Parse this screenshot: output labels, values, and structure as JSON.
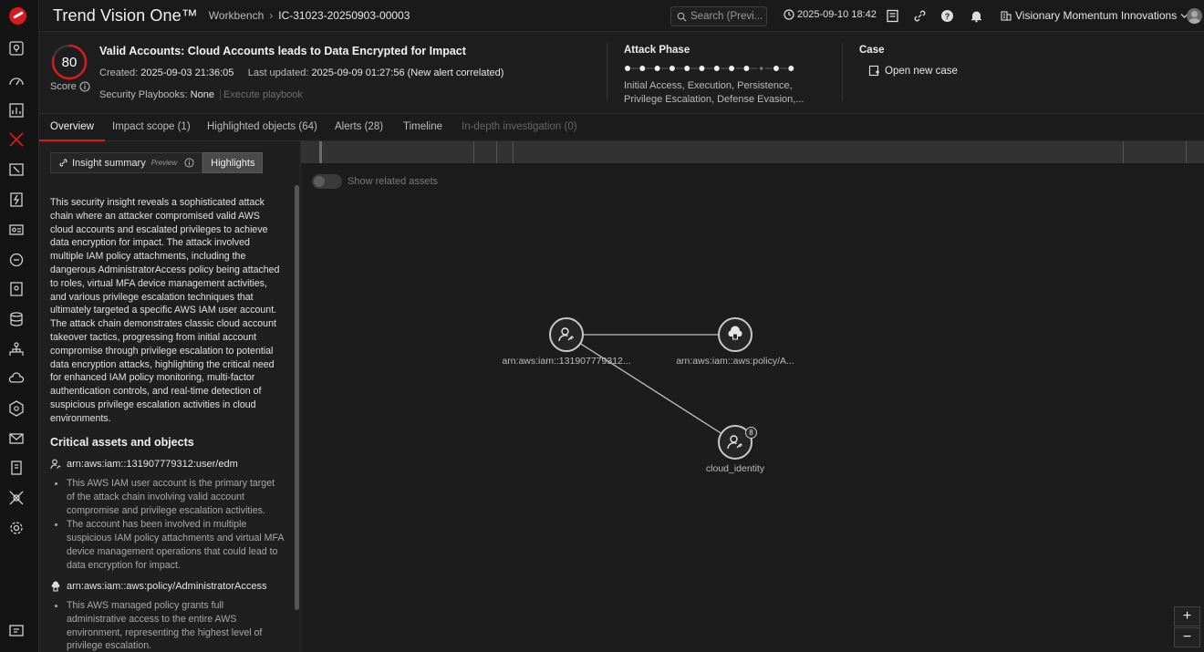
{
  "app": {
    "title": "Trend Vision One™",
    "breadcrumb_parent": "Workbench",
    "breadcrumb_sep": "›",
    "breadcrumb_current": "IC-31023-20250903-00003",
    "search_placeholder": "Search (Previ...",
    "datetime": "2025-09-10 18:42",
    "org": "Visionary Momentum Innovations"
  },
  "rail": {
    "items": [
      "map-pin-icon",
      "dashboard-icon",
      "reports-icon",
      "workbench-icon",
      "attack-surface-icon",
      "response-icon",
      "identity-icon",
      "threat-intel-icon",
      "endpoint-icon",
      "data-icon",
      "network-icon",
      "cloud-icon",
      "policy-icon",
      "email-icon",
      "mobile-icon",
      "xdr-icon",
      "settings-icon",
      "marketplace-icon"
    ]
  },
  "alert": {
    "score": "80",
    "score_value": 80,
    "score_label": "Score",
    "title": "Valid Accounts: Cloud Accounts leads to Data Encrypted for Impact",
    "created_label": "Created:",
    "created": "2025-09-03 21:36:05",
    "updated_label": "Last updated:",
    "updated": "2025-09-09 01:27:56 (New alert correlated)",
    "playbook_label": "Security Playbooks:",
    "playbook_value": "None",
    "playbook_action": "Execute playbook"
  },
  "attack_phase": {
    "heading": "Attack Phase",
    "phase_states": [
      1,
      1,
      1,
      1,
      1,
      1,
      1,
      1,
      1,
      0,
      1,
      1
    ],
    "description": "Initial Access, Execution, Persistence, Privilege Escalation, Defense Evasion,..."
  },
  "case": {
    "heading": "Case",
    "action": "Open new case"
  },
  "tabs": [
    {
      "label": "Overview",
      "state": "active"
    },
    {
      "label": "Impact scope (1)",
      "state": "normal"
    },
    {
      "label": "Highlighted objects (64)",
      "state": "normal"
    },
    {
      "label": "Alerts (28)",
      "state": "normal"
    },
    {
      "label": "Timeline",
      "state": "normal"
    },
    {
      "label": "In-depth investigation (0)",
      "state": "disabled"
    }
  ],
  "insight": {
    "summary_label": "Insight summary",
    "preview": "Preview",
    "highlights_label": "Highlights",
    "text": "This security insight reveals a sophisticated attack chain where an attacker compromised valid AWS cloud accounts and escalated privileges to achieve data encryption for impact. The attack involved multiple IAM policy attachments, including the dangerous AdministratorAccess policy being attached to roles, virtual MFA device management activities, and various privilege escalation techniques that ultimately targeted a specific AWS IAM user account. The attack chain demonstrates classic cloud account takeover tactics, progressing from initial account compromise through privilege escalation to potential data encryption attacks, highlighting the critical need for enhanced IAM policy monitoring, multi-factor authentication controls, and real-time detection of suspicious privilege escalation activities in cloud environments.",
    "critical_heading": "Critical assets and objects",
    "assets": [
      {
        "name": "arn:aws:iam::131907779312:user/edm",
        "icon": "user-key-icon",
        "bullets": [
          "This AWS IAM user account is the primary target of the attack chain involving valid account compromise and privilege escalation activities.",
          "The account has been involved in multiple suspicious IAM policy attachments and virtual MFA device management operations that could lead to data encryption for impact."
        ]
      },
      {
        "name": "arn:aws:iam::aws:policy/AdministratorAccess",
        "icon": "cloud-policy-icon",
        "bullets": [
          "This AWS managed policy grants full administrative access to the entire AWS environment, representing the highest level of privilege escalation."
        ]
      }
    ]
  },
  "graph": {
    "toggle_label": "Show related assets",
    "nodes": [
      {
        "label": "arn:aws:iam::131907779312...",
        "type": "user-key-icon"
      },
      {
        "label": "arn:aws:iam::aws:policy/A...",
        "type": "cloud-policy-icon"
      },
      {
        "label": "cloud_identity",
        "type": "user-key-icon",
        "badge": "8"
      }
    ],
    "zoom_in": "+",
    "zoom_out": "−"
  }
}
